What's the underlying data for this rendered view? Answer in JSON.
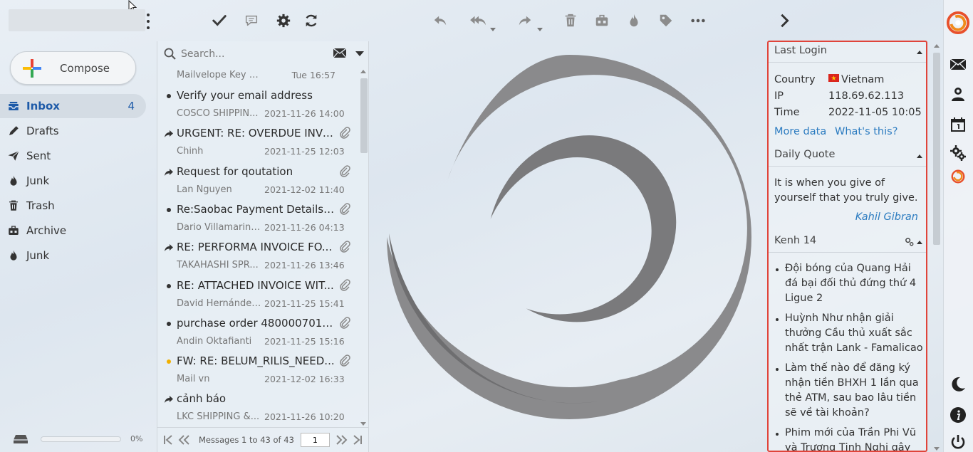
{
  "toolbar": {
    "icons": [
      "more-vertical-icon",
      "mark-read-icon",
      "threads-icon",
      "settings-icon",
      "refresh-icon",
      "reply-icon",
      "reply-all-icon",
      "forward-icon",
      "delete-icon",
      "archive-icon",
      "junk-icon",
      "tag-icon",
      "more-horizontal-icon",
      "chevron-right-icon"
    ]
  },
  "compose": {
    "label": "Compose"
  },
  "folders": [
    {
      "label": "Inbox",
      "count": "4",
      "icon": "inbox-icon",
      "active": true
    },
    {
      "label": "Drafts",
      "count": "",
      "icon": "pencil-icon"
    },
    {
      "label": "Sent",
      "count": "",
      "icon": "paper-plane-icon"
    },
    {
      "label": "Junk",
      "count": "",
      "icon": "fire-icon"
    },
    {
      "label": "Trash",
      "count": "",
      "icon": "trash-icon"
    },
    {
      "label": "Archive",
      "count": "",
      "icon": "archive-box-icon"
    },
    {
      "label": "Junk",
      "count": "",
      "icon": "fire-icon"
    }
  ],
  "quota": {
    "percent_label": "0%",
    "fraction": 0
  },
  "search": {
    "placeholder": "Search..."
  },
  "messages": [
    {
      "subject": "",
      "from": "Mailvelope Key Server",
      "date": "Tue 16:57",
      "flag": "none",
      "attachment": false
    },
    {
      "subject": "Verify your email address",
      "from": "COSCO SHIPPIN...",
      "date": "2021-11-26 14:00",
      "flag": "dot",
      "attachment": false
    },
    {
      "subject": "URGENT: RE: OVERDUE INVO...",
      "from": "Chinh",
      "date": "2021-11-25 12:03",
      "flag": "forwarded",
      "attachment": true
    },
    {
      "subject": "Request for qoutation",
      "from": "Lan Nguyen",
      "date": "2021-12-02 11:40",
      "flag": "forwarded",
      "attachment": true
    },
    {
      "subject": "Re:Saobac Payment Details f...",
      "from": "Dario Villamarin ...",
      "date": "2021-11-26 04:13",
      "flag": "dot",
      "attachment": true
    },
    {
      "subject": "RE: PERFORMA INVOICE FO...",
      "from": "TAKAHASHI SPR...",
      "date": "2021-11-26 13:46",
      "flag": "forwarded",
      "attachment": true
    },
    {
      "subject": "RE: ATTACHED INVOICE WIT...",
      "from": "David Hernández...",
      "date": "2021-11-25 15:41",
      "flag": "dot",
      "attachment": true
    },
    {
      "subject": "purchase order 4800007014- ...",
      "from": "Andin Oktafianti",
      "date": "2021-11-25 15:16",
      "flag": "dot",
      "attachment": true
    },
    {
      "subject": "FW: RE: BELUM_RILIS_NEED...",
      "from": "Mail vn",
      "date": "2021-12-02 16:33",
      "flag": "unread",
      "attachment": true
    },
    {
      "subject": "cảnh báo",
      "from": "LKC SHIPPING &...",
      "date": "2021-11-26 10:20",
      "flag": "forwarded",
      "attachment": false
    }
  ],
  "pager": {
    "text": "Messages 1 to 43 of 43",
    "page": "1"
  },
  "last_login": {
    "title": "Last Login",
    "country_label": "Country",
    "country": "Vietnam",
    "ip_label": "IP",
    "ip": "118.69.62.113",
    "time_label": "Time",
    "time": "2022-11-05 10:05",
    "more_data": "More data",
    "whats_this": "What's this?"
  },
  "daily_quote": {
    "title": "Daily Quote",
    "text": "It is when you give of yourself that you truly give.",
    "author": "Kahil Gibran"
  },
  "news": {
    "title": "Kenh 14",
    "items": [
      "Đội bóng của Quang Hải đá bại đối thủ đứng thứ 4 Ligue 2",
      "Huỳnh Như nhận giải thưởng Cầu thủ xuất sắc nhất trận Lank - Famalicao",
      "Làm thế nào để đăng ký nhận tiền BHXH 1 lần qua thẻ ATM, sau bao lâu tiền sẽ về tài khoản?",
      "Phim mới của Trần Phi Vũ và Trương Tịnh Nghi gây"
    ]
  },
  "appbar": {
    "icons": [
      "app-logo-icon",
      "mail-icon",
      "contacts-icon",
      "calendar-icon",
      "settings-gears-icon",
      "plugin-logo-icon",
      "dark-mode-icon",
      "about-icon",
      "logout-icon"
    ]
  },
  "colors": {
    "accent": "#1d5aa8",
    "link": "#2b7bc0",
    "highlight_border": "#e0443a",
    "unread_dot": "#f1b000"
  }
}
